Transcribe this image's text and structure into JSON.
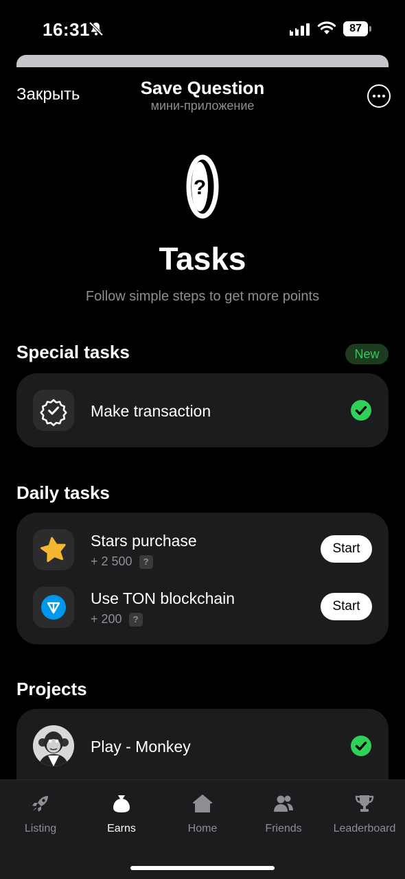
{
  "status": {
    "time": "16:31",
    "battery": "87"
  },
  "header": {
    "close": "Закрыть",
    "title": "Save Question",
    "subtitle": "мини-приложение"
  },
  "hero": {
    "title": "Tasks",
    "subtitle": "Follow simple steps to get more points"
  },
  "special": {
    "title": "Special tasks",
    "badge": "New",
    "items": [
      {
        "title": "Make transaction",
        "done": true
      }
    ]
  },
  "daily": {
    "title": "Daily tasks",
    "items": [
      {
        "title": "Stars purchase",
        "reward": "+ 2 500",
        "help": "?",
        "action": "Start"
      },
      {
        "title": "Use TON blockchain",
        "reward": "+ 200",
        "help": "?",
        "action": "Start"
      }
    ]
  },
  "projects": {
    "title": "Projects",
    "items": [
      {
        "title": "Play - Monkey",
        "done": true
      }
    ]
  },
  "tabs": [
    {
      "label": "Listing",
      "icon": "rocket-icon",
      "active": false
    },
    {
      "label": "Earns",
      "icon": "money-bag-icon",
      "active": true
    },
    {
      "label": "Home",
      "icon": "home-icon",
      "active": false
    },
    {
      "label": "Friends",
      "icon": "friends-icon",
      "active": false
    },
    {
      "label": "Leaderboard",
      "icon": "trophy-icon",
      "active": false
    }
  ],
  "colors": {
    "background": "#000000",
    "card": "#1c1c1e",
    "success": "#30d158",
    "star": "#f5b731",
    "ton": "#0098ea"
  }
}
